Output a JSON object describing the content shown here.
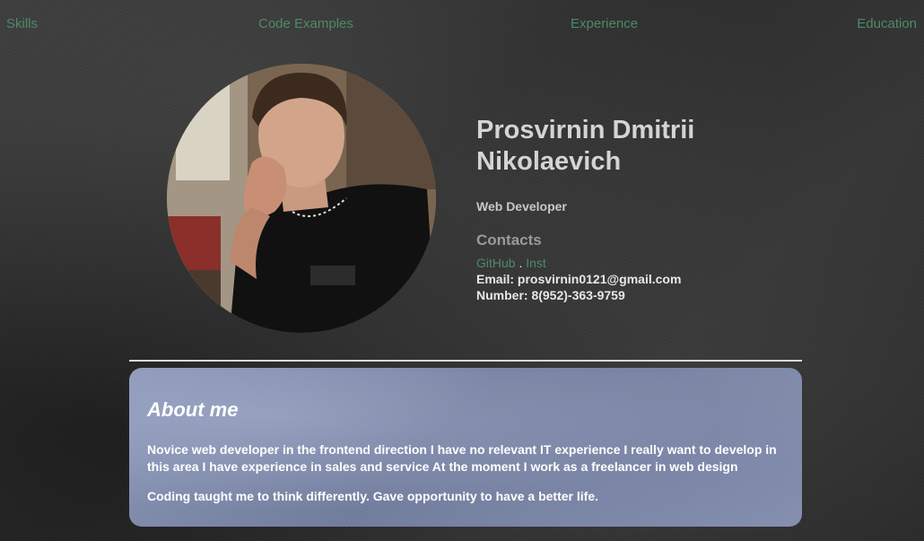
{
  "nav": {
    "items": [
      {
        "label": "Skills"
      },
      {
        "label": "Code Examples"
      },
      {
        "label": "Experience"
      },
      {
        "label": "Education"
      }
    ]
  },
  "profile": {
    "name_line1": "Prosvirnin Dmitrii",
    "name_line2": "Nikolaevich",
    "role": "Web Developer",
    "contacts_title": "Contacts",
    "link_github": "GitHub",
    "link_separator": " . ",
    "link_inst": "Inst",
    "email_line": "Email: prosvirnin0121@gmail.com",
    "number_line": "Number: 8(952)-363-9759"
  },
  "about": {
    "title": "About me",
    "paragraph1": "Novice web developer in the frontend direction I have no relevant IT experience I really want to develop in this area I have experience in sales and service At the moment I work as a freelancer in web design",
    "paragraph2": "Coding taught me to think differently. Gave opportunity to have a better life."
  },
  "colors": {
    "nav_link": "#4d8a68",
    "background": "#2e2e2e",
    "card": "#7d88a8"
  }
}
